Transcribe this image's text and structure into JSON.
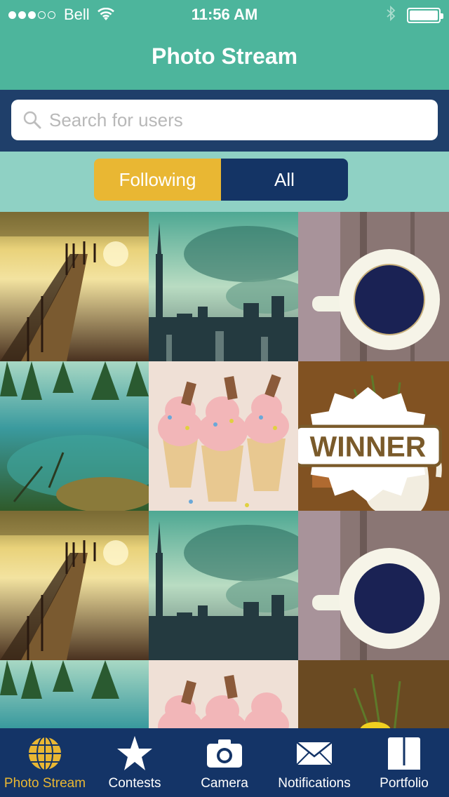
{
  "status_bar": {
    "carrier": "Bell",
    "time": "11:56 AM",
    "signal_bars_filled": 3,
    "signal_bars_total": 5,
    "battery_level": 1.0
  },
  "nav": {
    "title": "Photo Stream"
  },
  "search": {
    "placeholder": "Search for users",
    "value": "",
    "icon": "search-icon"
  },
  "segmented": {
    "options": [
      "Following",
      "All"
    ],
    "selected": "Following"
  },
  "photos": [
    {
      "subject": "pier"
    },
    {
      "subject": "city-skyline"
    },
    {
      "subject": "coffee-cup"
    },
    {
      "subject": "lake-forest"
    },
    {
      "subject": "ice-cream-cones"
    },
    {
      "subject": "daffodil-vase",
      "badge": "WINNER"
    },
    {
      "subject": "pier"
    },
    {
      "subject": "city-skyline"
    },
    {
      "subject": "coffee-cup"
    },
    {
      "subject": "lake-forest"
    },
    {
      "subject": "ice-cream-cones"
    },
    {
      "subject": "daffodil-vase"
    }
  ],
  "tabbar": {
    "items": [
      {
        "label": "Photo Stream",
        "icon": "globe-icon",
        "active": true
      },
      {
        "label": "Contests",
        "icon": "star-icon",
        "active": false
      },
      {
        "label": "Camera",
        "icon": "camera-icon",
        "active": false
      },
      {
        "label": "Notifications",
        "icon": "envelope-icon",
        "active": false
      },
      {
        "label": "Portfolio",
        "icon": "book-icon",
        "active": false
      }
    ]
  },
  "colors": {
    "header": "#4db59c",
    "search_band": "#1f3f6a",
    "segment_band": "#8fd1c4",
    "accent": "#e9b733",
    "navy": "#143467"
  }
}
